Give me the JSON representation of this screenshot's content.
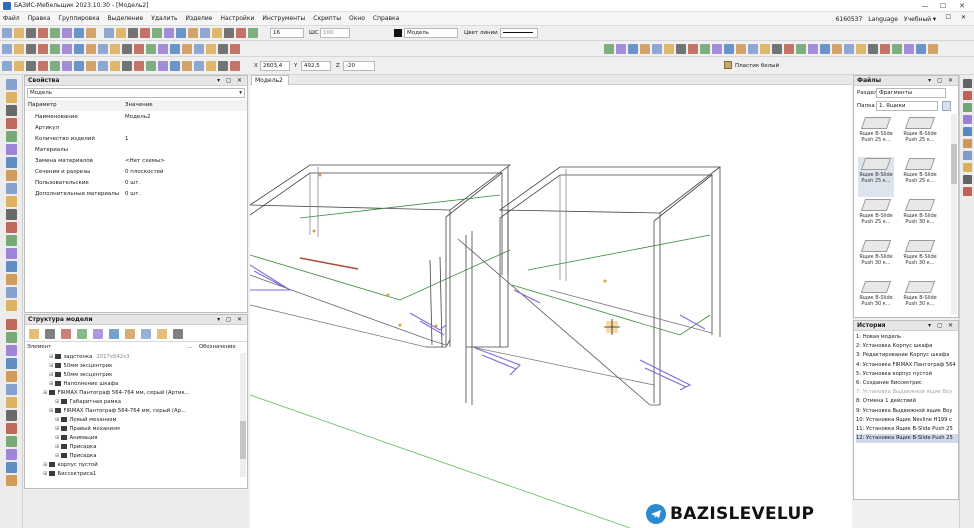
{
  "window": {
    "title": "БАЗИС-Мебельщик 2023.10.30 - [Модель2]",
    "minimize": "—",
    "maximize": "☐",
    "close": "✕"
  },
  "menu": {
    "items": [
      "Файл",
      "Правка",
      "Группировка",
      "Выделение",
      "Удалить",
      "Изделие",
      "Настройки",
      "Инструменты",
      "Скрипты",
      "Окно",
      "Справка"
    ],
    "account_id": "6160537",
    "language": "Language",
    "mode": "Учебный ▾"
  },
  "toolbar": {
    "line_width": "16",
    "scale_label": "ШС",
    "scale_value": "100",
    "layer_value": "Модель",
    "line_color_label": "Цвет линии",
    "coord_x_label": "X",
    "coord_x": "2603,4",
    "coord_y_label": "Y",
    "coord_y": "492,5",
    "coord_z_label": "Z",
    "coord_z": "-20",
    "material_value": "Пластик белый"
  },
  "properties": {
    "title": "Свойства",
    "selector": "Модель",
    "col_param": "Параметр",
    "col_value": "Значение",
    "rows": [
      {
        "name": "Наименование",
        "value": "Модель2"
      },
      {
        "name": "Артикул",
        "value": ""
      },
      {
        "name": "Количество изделий",
        "value": "1"
      },
      {
        "name": "Материалы",
        "value": ""
      },
      {
        "name": "Замена материалов",
        "value": "<Нет схемы>"
      },
      {
        "name": "Сечения и разрезы",
        "value": "0 плоскостей"
      },
      {
        "name": "Пользовательские",
        "value": "0 шт."
      },
      {
        "name": "Дополнительные материалы",
        "value": "0 шт."
      }
    ]
  },
  "structure": {
    "title": "Структура модели",
    "col_element": "Элемент",
    "col_dots": "...",
    "col_designation": "Обозначение",
    "rows": [
      {
        "label": "задстенка",
        "note": "2017х642х3",
        "indent": 3
      },
      {
        "label": "50мм эксцентрик",
        "note": "",
        "indent": 3
      },
      {
        "label": "50мм эксцентрик",
        "note": "",
        "indent": 3
      },
      {
        "label": "Наполнение шкафа",
        "note": "",
        "indent": 3
      },
      {
        "label": "FIRMAX Пантограф 564-764 мм, серый (Артик...",
        "note": "",
        "indent": 2
      },
      {
        "label": "Габаритная рамка",
        "note": "",
        "indent": 4
      },
      {
        "label": "FIRMAX Пантограф 564-764 мм, серый (Ар...",
        "note": "",
        "indent": 3
      },
      {
        "label": "Левый механизм",
        "note": "",
        "indent": 4
      },
      {
        "label": "Правый механизм",
        "note": "",
        "indent": 4
      },
      {
        "label": "Анимация",
        "note": "",
        "indent": 4
      },
      {
        "label": "Присадка",
        "note": "",
        "indent": 4
      },
      {
        "label": "Присадка",
        "note": "",
        "indent": 4
      },
      {
        "label": "корпус пустой",
        "note": "",
        "indent": 2
      },
      {
        "label": "Биссектриса1",
        "note": "",
        "indent": 2
      }
    ]
  },
  "viewport": {
    "tab": "Модель2"
  },
  "files": {
    "title": "Файлы",
    "section_label": "Раздел",
    "section_value": "Фрагменты",
    "folder_label": "Папка",
    "folder_value": "1. Ящики",
    "thumbs": [
      "Ящик B-Slide Push 25 к...",
      "Ящик B-Slide Push 25 к...",
      "Ящик B-Slide Push 25 к...",
      "Ящик B-Slide Push 25 к...",
      "Ящик B-Slide Push 25 к...",
      "Ящик B-Slide Push 30 к...",
      "Ящик B-Slide Push 30 к...",
      "Ящик B-Slide Push 30 к...",
      "Ящик B-Slide Push 30 к...",
      "Ящик B-Slide Push 30 к..."
    ]
  },
  "history": {
    "title": "История",
    "rows": [
      {
        "text": "1: Новая модель",
        "state": "normal"
      },
      {
        "text": "2: Установка Корпус шкафа",
        "state": "normal"
      },
      {
        "text": "3: Редактирование Корпус шкафа",
        "state": "normal"
      },
      {
        "text": "4: Установка FIRMAX Пантограф 564",
        "state": "normal"
      },
      {
        "text": "5: Установка корпус пустой",
        "state": "normal"
      },
      {
        "text": "6: Создание биссектрис",
        "state": "normal"
      },
      {
        "text": "7: Установка Выдвижной ящик Boy",
        "state": "disabled"
      },
      {
        "text": "8: Отмена 1 действий",
        "state": "normal"
      },
      {
        "text": "9: Установка Выдвижной ящик Boy",
        "state": "normal"
      },
      {
        "text": "10: Установка Ящик Nevline H199 с",
        "state": "normal"
      },
      {
        "text": "11: Установка Ящик B-Slide Push 25",
        "state": "normal"
      },
      {
        "text": "12: Установка Ящик B-Slide Push 25",
        "state": "selected"
      }
    ]
  },
  "watermark": {
    "text": "BAZISLEVELUP"
  }
}
